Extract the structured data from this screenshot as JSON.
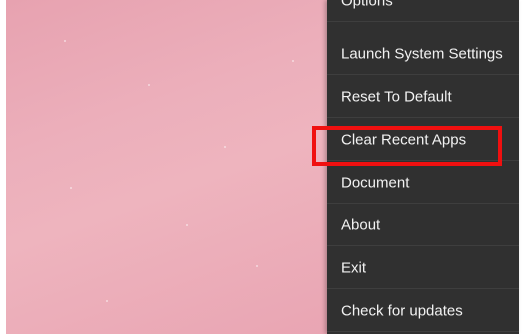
{
  "menu": {
    "items": [
      {
        "label": "Options"
      },
      {
        "label": "Launch System Settings"
      },
      {
        "label": "Reset To Default"
      },
      {
        "label": "Clear Recent Apps"
      },
      {
        "label": "Document"
      },
      {
        "label": "About"
      },
      {
        "label": "Exit"
      },
      {
        "label": "Check for updates"
      }
    ]
  },
  "colors": {
    "menu_background": "#303030",
    "menu_text": "#f2f2f2",
    "highlight": "#f01010",
    "wallpaper": "#ecafbb"
  }
}
